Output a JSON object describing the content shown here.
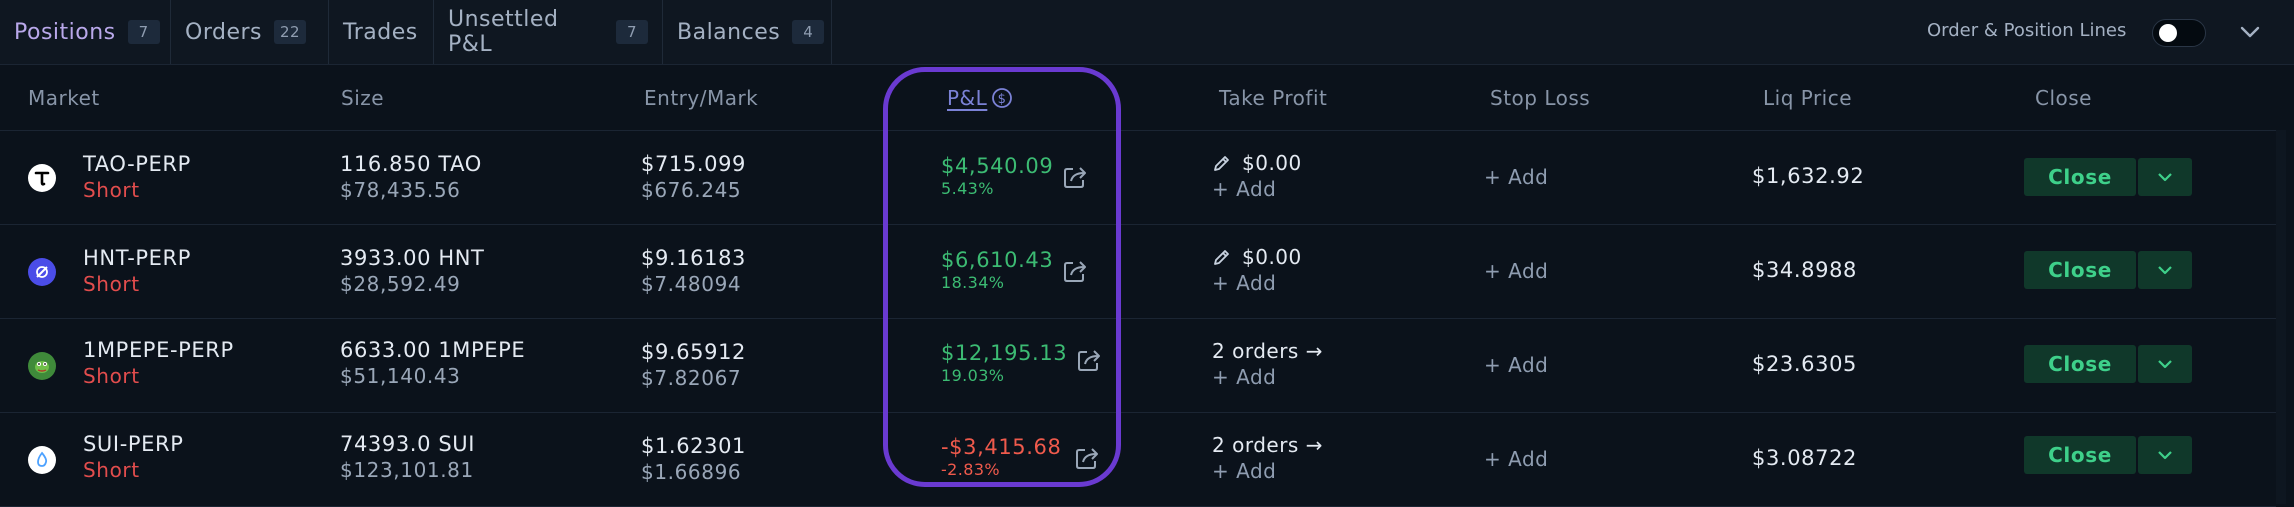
{
  "tabs": [
    {
      "label": "Positions",
      "count": "7"
    },
    {
      "label": "Orders",
      "count": "22"
    },
    {
      "label": "Trades",
      "count": ""
    },
    {
      "label": "Unsettled P&L",
      "count": "7"
    },
    {
      "label": "Balances",
      "count": "4"
    }
  ],
  "toolbar": {
    "lines_label": "Order & Position Lines",
    "lines_toggle": "off"
  },
  "columns": {
    "market": "Market",
    "size": "Size",
    "entry_mark": "Entry/Mark",
    "pnl": "P&L",
    "take_profit": "Take Profit",
    "stop_loss": "Stop Loss",
    "liq_price": "Liq Price",
    "close": "Close"
  },
  "rows": [
    {
      "market": "TAO-PERP",
      "side": "Short",
      "icon": "tao-icon",
      "size": "116.850 TAO",
      "size_usd": "$78,435.56",
      "entry": "$715.099",
      "mark": "$676.245",
      "pnl": "$4,540.09",
      "pnl_pct": "5.43%",
      "pnl_sign": "positive",
      "tp_main": "$0.00",
      "tp_add": "+ Add",
      "sl_add": "+ Add",
      "liq": "$1,632.92",
      "close_label": "Close"
    },
    {
      "market": "HNT-PERP",
      "side": "Short",
      "icon": "helium-icon",
      "size": "3933.00 HNT",
      "size_usd": "$28,592.49",
      "entry": "$9.16183",
      "mark": "$7.48094",
      "pnl": "$6,610.43",
      "pnl_pct": "18.34%",
      "pnl_sign": "positive",
      "tp_main": "$0.00",
      "tp_add": "+ Add",
      "sl_add": "+ Add",
      "liq": "$34.8988",
      "close_label": "Close"
    },
    {
      "market": "1MPEPE-PERP",
      "side": "Short",
      "icon": "pepe-icon",
      "size": "6633.00 1MPEPE",
      "size_usd": "$51,140.43",
      "entry": "$9.65912",
      "mark": "$7.82067",
      "pnl": "$12,195.13",
      "pnl_pct": "19.03%",
      "pnl_sign": "positive",
      "tp_main": "2 orders →",
      "tp_add": "+ Add",
      "sl_add": "+ Add",
      "liq": "$23.6305",
      "close_label": "Close"
    },
    {
      "market": "SUI-PERP",
      "side": "Short",
      "icon": "sui-icon",
      "size": "74393.0 SUI",
      "size_usd": "$123,101.81",
      "entry": "$1.62301",
      "mark": "$1.66896",
      "pnl": "-$3,415.68",
      "pnl_pct": "-2.83%",
      "pnl_sign": "negative",
      "tp_main": "2 orders →",
      "tp_add": "+ Add",
      "sl_add": "+ Add",
      "liq": "$3.08722",
      "close_label": "Close"
    }
  ],
  "colors": {
    "background": "#0b121b",
    "profit": "#3cbb73",
    "loss": "#ef5a4c",
    "short": "#e24d4d",
    "close_button": "#10382a",
    "highlight": "#6a3ad1"
  }
}
